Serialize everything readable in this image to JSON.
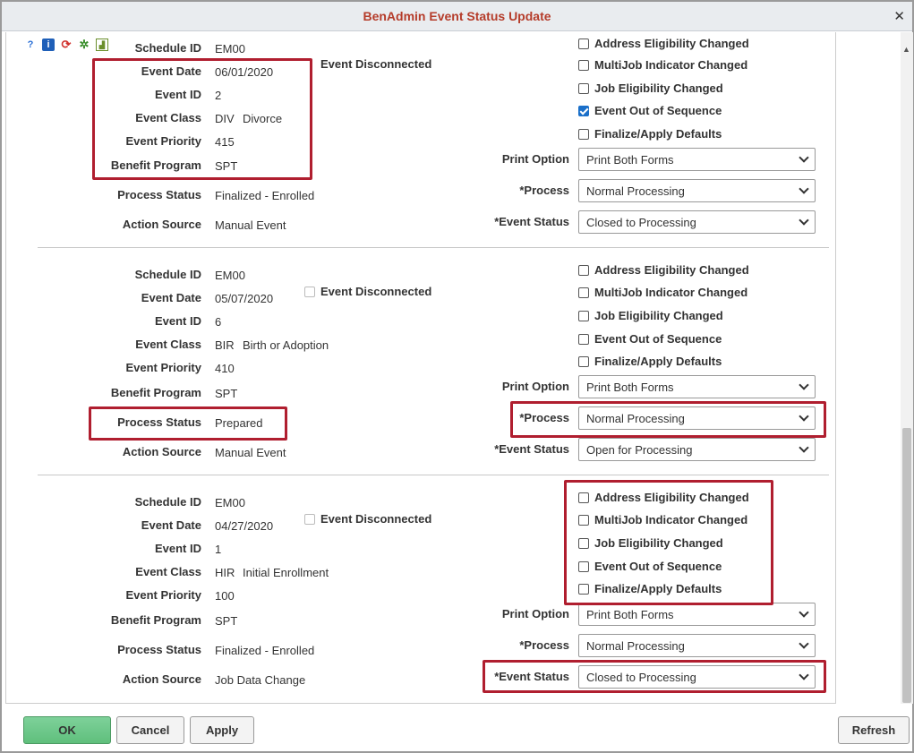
{
  "window": {
    "title": "BenAdmin Event Status Update",
    "close_icon": "✕"
  },
  "toolbar_icons": [
    "help-icon",
    "info-icon",
    "refresh-icon",
    "settings-icon",
    "chart-icon"
  ],
  "labels": {
    "schedule_id": "Schedule ID",
    "event_date": "Event Date",
    "event_id": "Event ID",
    "event_class": "Event Class",
    "event_priority": "Event Priority",
    "benefit_program": "Benefit Program",
    "process_status": "Process Status",
    "action_source": "Action Source",
    "event_disconnected": "Event Disconnected",
    "address_elig": "Address Eligibility Changed",
    "multijob": "MultiJob Indicator Changed",
    "job_elig": "Job Eligibility Changed",
    "out_of_seq": "Event Out of Sequence",
    "finalize": "Finalize/Apply Defaults",
    "print_option": "Print Option",
    "process": "*Process",
    "event_status": "*Event Status"
  },
  "events": [
    {
      "schedule_id": "EM00",
      "event_date": "06/01/2020",
      "event_id": "2",
      "event_class_code": "DIV",
      "event_class_desc": "Divorce",
      "event_priority": "415",
      "benefit_program": "SPT",
      "process_status": "Finalized - Enrolled",
      "action_source": "Manual Event",
      "print_option": "Print Both Forms",
      "process": "Normal Processing",
      "event_status": "Closed to Processing",
      "out_of_seq_checked": true
    },
    {
      "schedule_id": "EM00",
      "event_date": "05/07/2020",
      "event_id": "6",
      "event_class_code": "BIR",
      "event_class_desc": "Birth or Adoption",
      "event_priority": "410",
      "benefit_program": "SPT",
      "process_status": "Prepared",
      "action_source": "Manual Event",
      "print_option": "Print Both Forms",
      "process": "Normal Processing",
      "event_status": "Open for Processing",
      "out_of_seq_checked": false
    },
    {
      "schedule_id": "EM00",
      "event_date": "04/27/2020",
      "event_id": "1",
      "event_class_code": "HIR",
      "event_class_desc": "Initial Enrollment",
      "event_priority": "100",
      "benefit_program": "SPT",
      "process_status": "Finalized - Enrolled",
      "action_source": "Job Data Change",
      "print_option": "Print Both Forms",
      "process": "Normal Processing",
      "event_status": "Closed to Processing",
      "out_of_seq_checked": false
    }
  ],
  "buttons": {
    "ok": "OK",
    "cancel": "Cancel",
    "apply": "Apply",
    "refresh": "Refresh"
  },
  "colors": {
    "title": "#b53c2a",
    "highlight": "#b01e2f",
    "ok_button": "#6cc88a",
    "checkbox": "#1a6fc9"
  }
}
